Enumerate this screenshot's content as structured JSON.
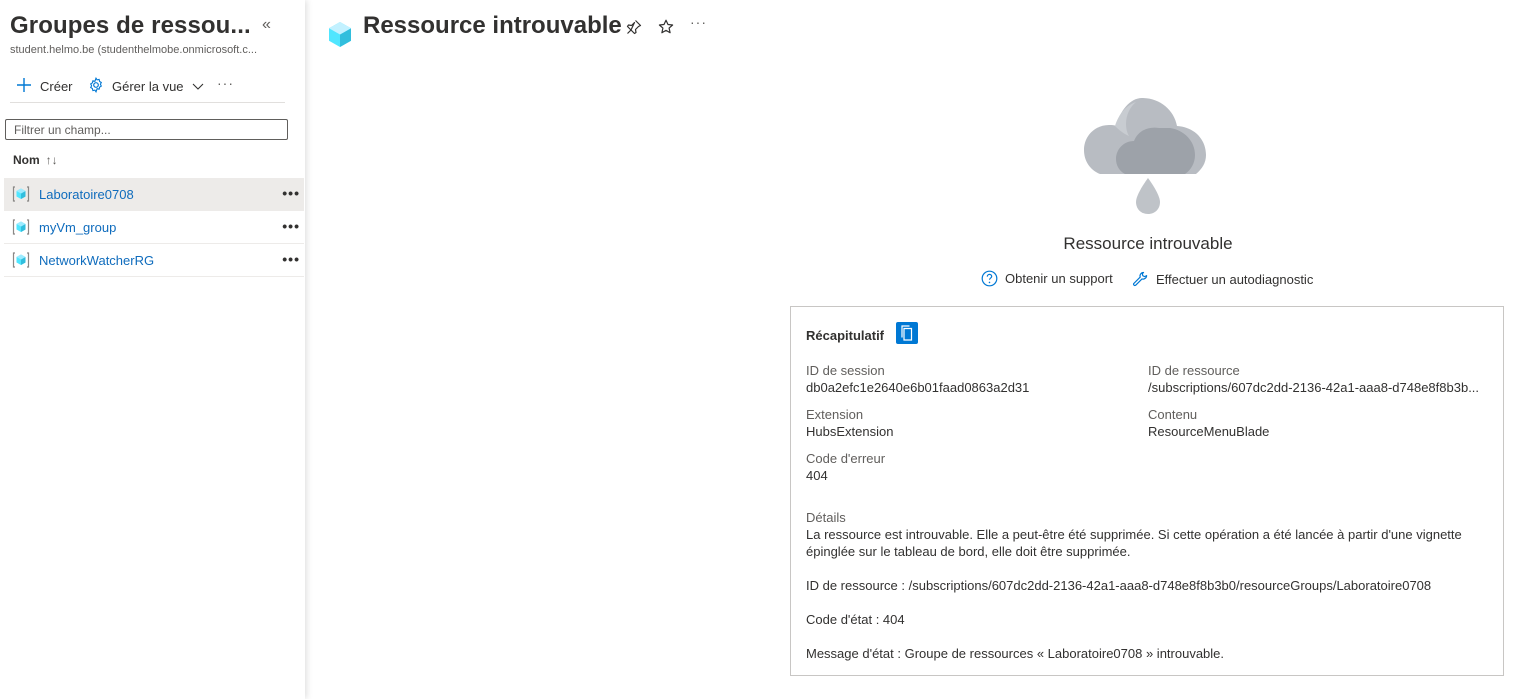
{
  "left_pane": {
    "title": "Groupes de ressou...",
    "collapse_glyph": "«",
    "subtitle": "student.helmo.be (studenthelmobe.onmicrosoft.c...",
    "toolbar": {
      "create_label": "Créer",
      "manage_view_label": "Gérer la vue",
      "more_label": "···"
    },
    "filter": {
      "placeholder": "Filtrer un champ...",
      "value": ""
    },
    "column_header": {
      "label": "Nom",
      "sort_glyph": "↑↓"
    },
    "items": [
      {
        "name": "Laboratoire0708",
        "selected": true,
        "more": "•••"
      },
      {
        "name": "myVm_group",
        "selected": false,
        "more": "•••"
      },
      {
        "name": "NetworkWatcherRG",
        "selected": false,
        "more": "•••"
      }
    ]
  },
  "main": {
    "title": "Ressource introuvable",
    "more_label": "···",
    "error_title": "Ressource introuvable",
    "links": {
      "support": "Obtenir un support",
      "diagnostic": "Effectuer un autodiagnostic"
    },
    "summary": {
      "title": "Récapitulatif",
      "session_id_label": "ID de session",
      "session_id": "db0a2efc1e2640e6b01faad0863a2d31",
      "resource_id_label": "ID de ressource",
      "resource_id": "/subscriptions/607dc2dd-2136-42a1-aaa8-d748e8f8b3b...",
      "extension_label": "Extension",
      "extension": "HubsExtension",
      "content_label": "Contenu",
      "content": "ResourceMenuBlade",
      "error_code_label": "Code d'erreur",
      "error_code": "404",
      "details_label": "Détails",
      "details_text": "La ressource est introuvable. Elle a peut-être été supprimée. Si cette opération a été lancée à partir d'une vignette épinglée sur le tableau de bord, elle doit être supprimée.",
      "details_resource_id": "ID de ressource : /subscriptions/607dc2dd-2136-42a1-aaa8-d748e8f8b3b0/resourceGroups/Laboratoire0708",
      "details_status_code": "Code d'état : 404",
      "details_status_message": "Message d'état : Groupe de ressources « Laboratoire0708 » introuvable."
    }
  },
  "colors": {
    "accent": "#0078d4",
    "link": "#0f6cbd",
    "selected_row": "#edebe9",
    "text": "#323130",
    "secondary_text": "#605e5c",
    "cloud_gray": "#a9aeb5"
  },
  "icons": {
    "collapse": "double-chevron-left-icon",
    "create": "plus-icon",
    "manage_view": "gear-icon",
    "dropdown": "chevron-down-icon",
    "resource_group": "resource-group-cube-icon",
    "pin": "pin-icon",
    "favorite": "star-icon",
    "error_illustration": "cloud-rain-icon",
    "help": "question-circle-icon",
    "wrench": "wrench-icon",
    "copy": "copy-icon"
  }
}
